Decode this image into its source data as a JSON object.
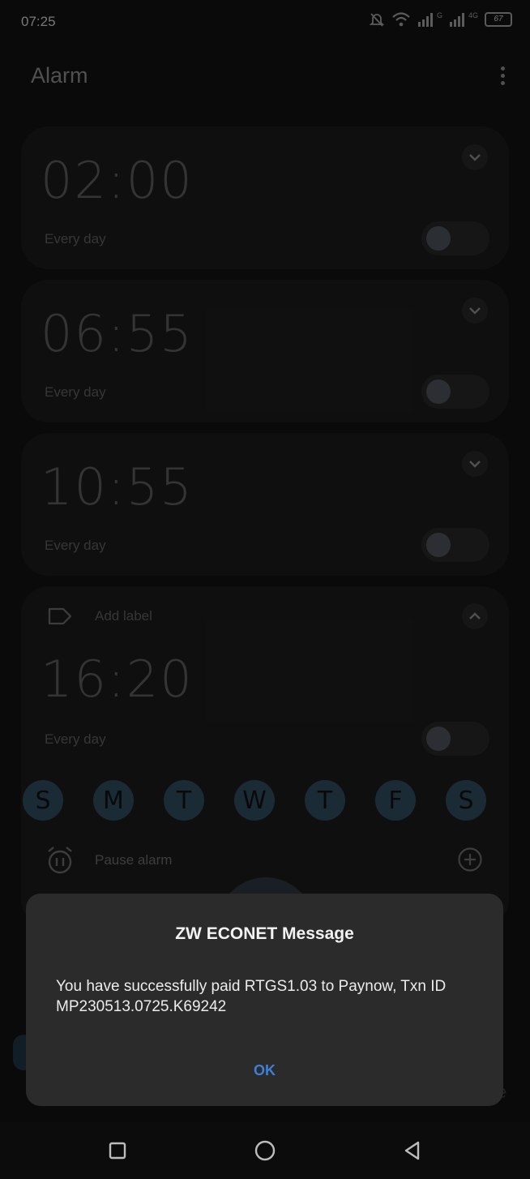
{
  "status_bar": {
    "time": "07:25",
    "network_label_1": "G",
    "network_label_2": "4G",
    "battery": "67"
  },
  "app": {
    "title": "Alarm"
  },
  "alarms": [
    {
      "time": "02:00",
      "repeat": "Every day",
      "enabled": false
    },
    {
      "time": "06:55",
      "repeat": "Every day",
      "enabled": false
    },
    {
      "time": "10:55",
      "repeat": "Every day",
      "enabled": false
    },
    {
      "time": "16:20",
      "repeat": "Every day",
      "enabled": false,
      "label_placeholder": "Add label",
      "days": [
        "S",
        "M",
        "T",
        "W",
        "T",
        "F",
        "S"
      ],
      "pause_label": "Pause alarm"
    }
  ],
  "dialog": {
    "title": "ZW ECONET Message",
    "body": "You have successfully paid RTGS1.03 to Paynow, Txn ID MP230513.0725.K69242",
    "ok": "OK"
  },
  "bottom_peek": {
    "right_text": "e"
  },
  "colors": {
    "accent": "#3f7fd9",
    "day_chip": "#2e4a5e",
    "dialog_bg": "#2b2b2b"
  }
}
